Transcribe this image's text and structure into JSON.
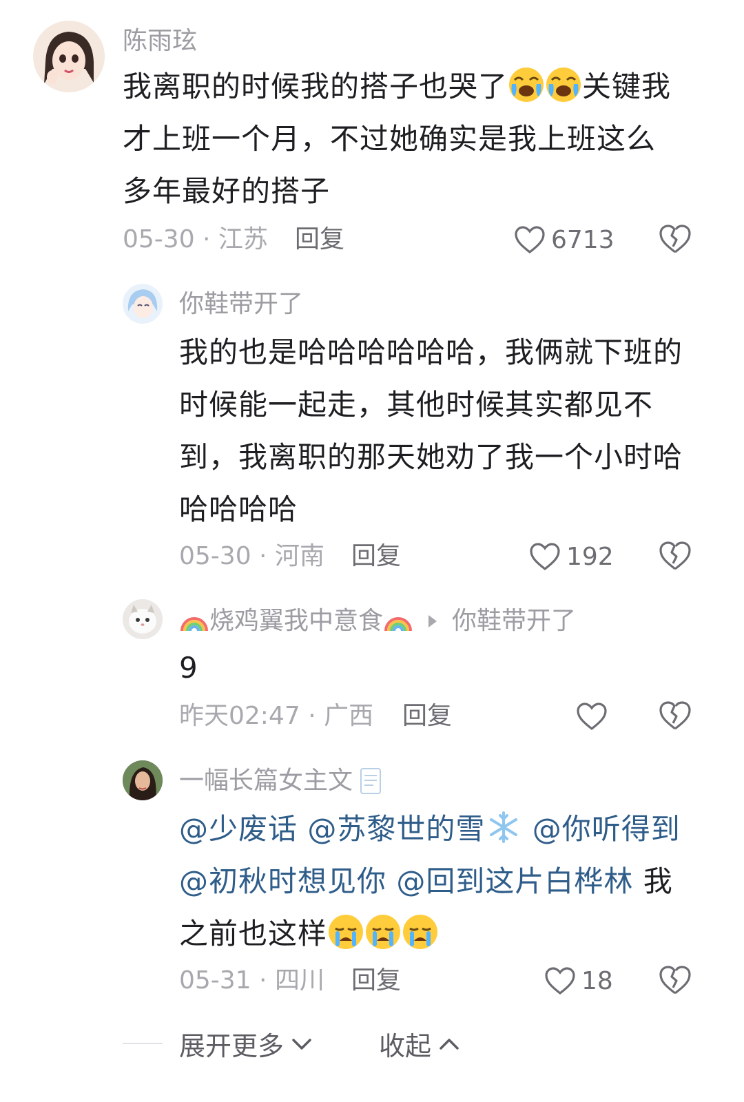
{
  "comments": [
    {
      "username": "陈雨玹",
      "text_a": "我离职的时候我的搭子也哭了",
      "text_b": "关键我",
      "text_line2": "才上班一个月，不过她确实是我上班这么",
      "text_line3": "多年最好的搭子",
      "emojis": [
        "crying-laugh-emoji",
        "crying-laugh-emoji"
      ],
      "meta": "05-30 · 江苏",
      "reply_label": "回复",
      "likes": "6713"
    },
    {
      "username": "你鞋带开了",
      "text_line1": "我的也是哈哈哈哈哈哈，我俩就下班的",
      "text_line2": "时候能一起走，其他时候其实都见不",
      "text_line3": "到，我离职的那天她劝了我一个小时哈",
      "text_line4": "哈哈哈哈",
      "meta": "05-30 · 河南",
      "reply_label": "回复",
      "likes": "192"
    },
    {
      "username": "烧鸡翼我中意食",
      "reply_to": "你鞋带开了",
      "name_emojis": [
        "rainbow-emoji",
        "rainbow-emoji"
      ],
      "text": "9",
      "meta": "昨天02:47 · 广西",
      "reply_label": "回复",
      "likes": ""
    },
    {
      "username": "一幅长篇女主文",
      "name_emoji": "document-emoji",
      "mentions_line1": [
        "@少废话",
        "@苏黎世的雪",
        "@你听得到"
      ],
      "mentions_line2": [
        "@初秋时想见你",
        "@回到这片白桦林"
      ],
      "text_tail": "我",
      "text_line3": "之前也这样",
      "emojis": [
        "crying-emoji",
        "crying-emoji",
        "crying-emoji"
      ],
      "meta": "05-31 · 四川",
      "reply_label": "回复",
      "likes": "18"
    }
  ],
  "footer": {
    "expand_label": "展开更多",
    "collapse_label": "收起"
  },
  "colors": {
    "mention": "#2f5d8a",
    "meta": "#a8a8ae",
    "text": "#1e1e22"
  }
}
